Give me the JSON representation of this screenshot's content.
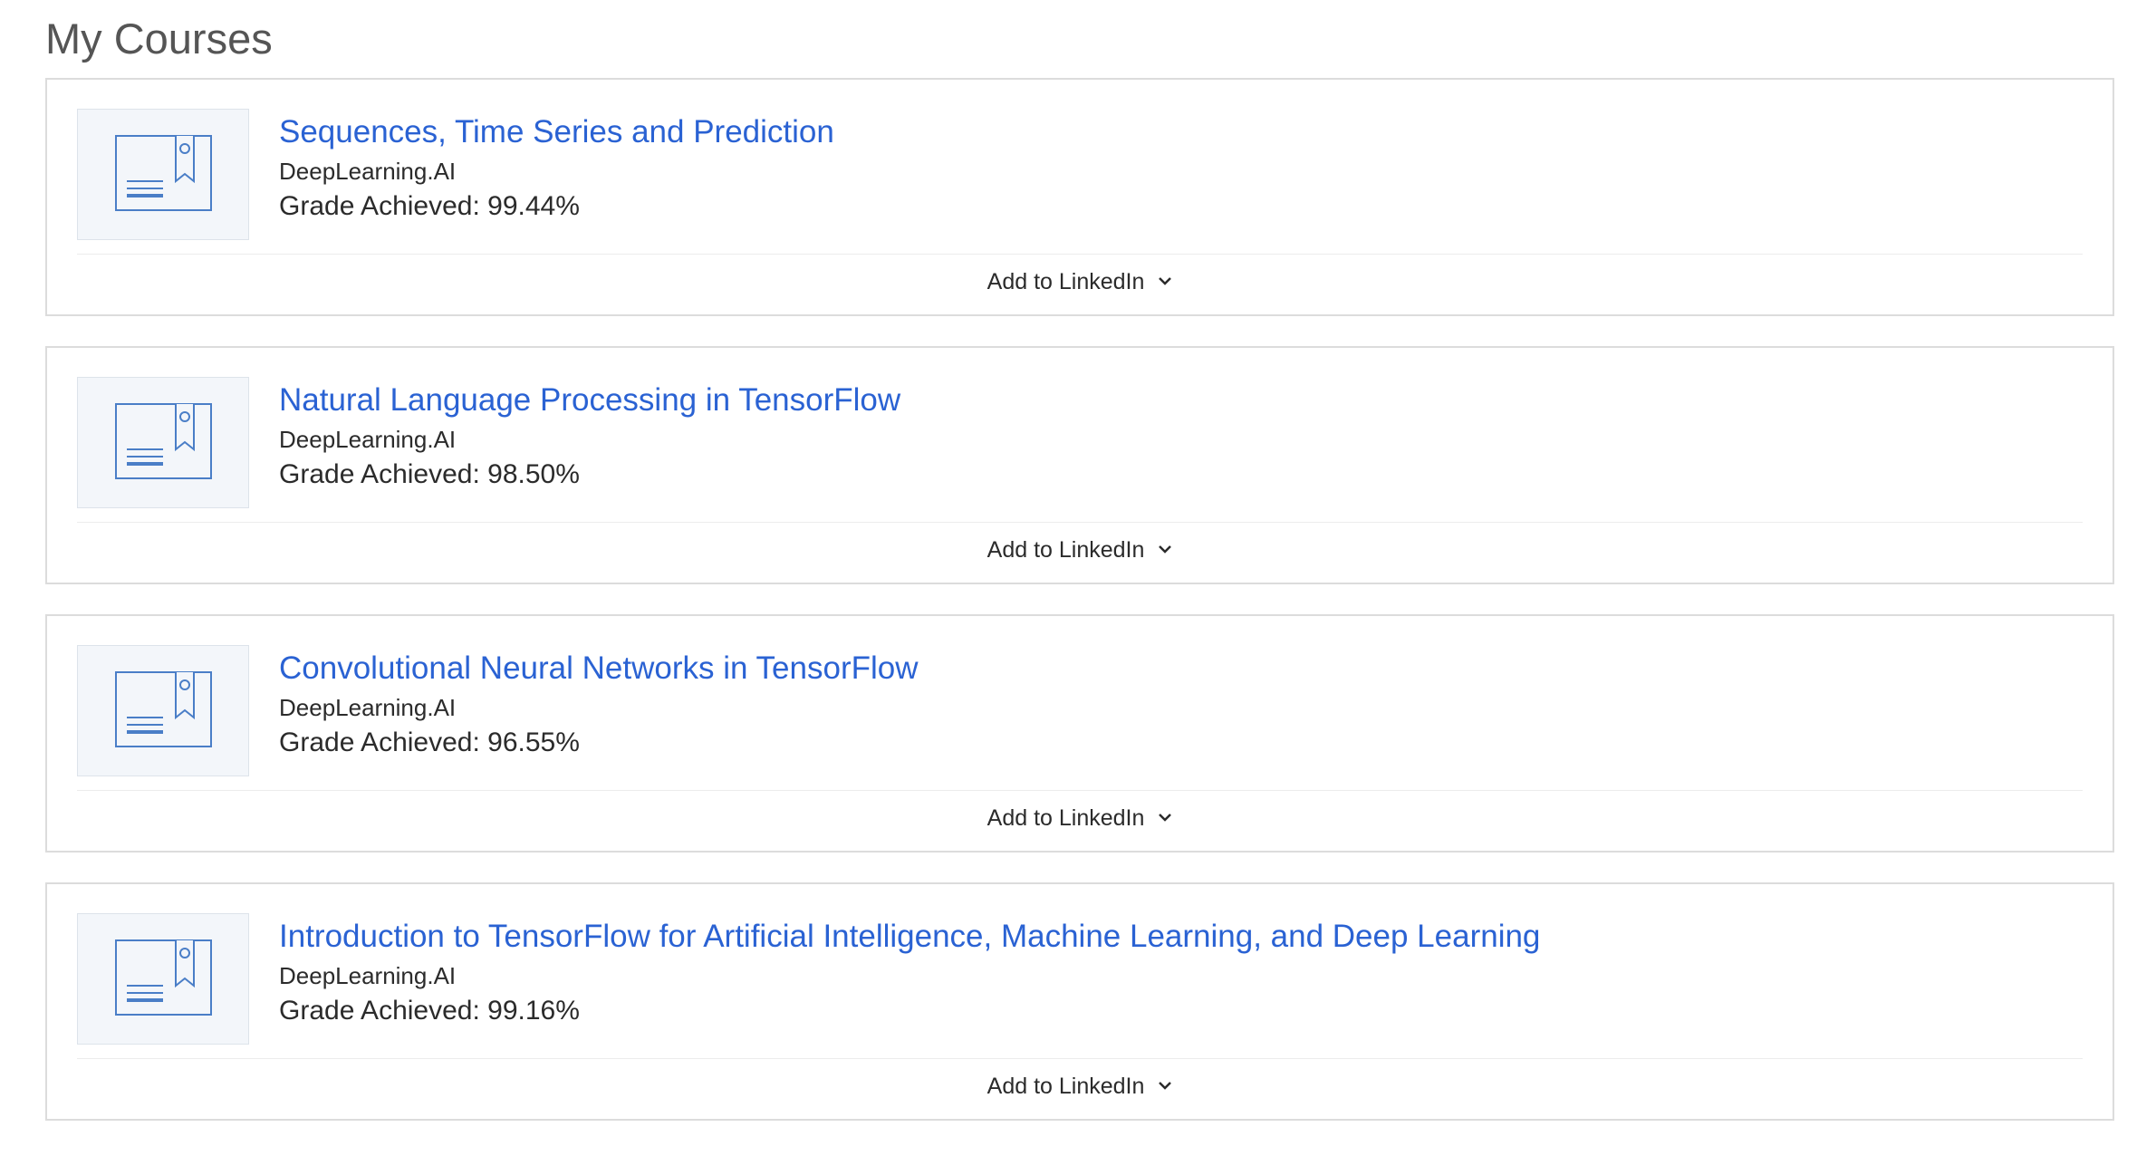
{
  "page": {
    "title": "My Courses"
  },
  "colors": {
    "link": "#2a62d3",
    "icon": "#4a7ec7",
    "thumb_bg": "#f3f6fa",
    "border": "#dcdcdc"
  },
  "courses": [
    {
      "title": "Sequences, Time Series and Prediction",
      "partner": "DeepLearning.AI",
      "grade_label": "Grade Achieved:",
      "grade_value": "99.44%",
      "thumbnail_icon": "certificate-icon",
      "linkedin_label": "Add to LinkedIn"
    },
    {
      "title": "Natural Language Processing in TensorFlow",
      "partner": "DeepLearning.AI",
      "grade_label": "Grade Achieved:",
      "grade_value": "98.50%",
      "thumbnail_icon": "certificate-icon",
      "linkedin_label": "Add to LinkedIn"
    },
    {
      "title": "Convolutional Neural Networks in TensorFlow",
      "partner": "DeepLearning.AI",
      "grade_label": "Grade Achieved:",
      "grade_value": "96.55%",
      "thumbnail_icon": "certificate-icon",
      "linkedin_label": "Add to LinkedIn"
    },
    {
      "title": "Introduction to TensorFlow for Artificial Intelligence, Machine Learning, and Deep Learning",
      "partner": "DeepLearning.AI",
      "grade_label": "Grade Achieved:",
      "grade_value": "99.16%",
      "thumbnail_icon": "certificate-icon",
      "linkedin_label": "Add to LinkedIn"
    }
  ]
}
